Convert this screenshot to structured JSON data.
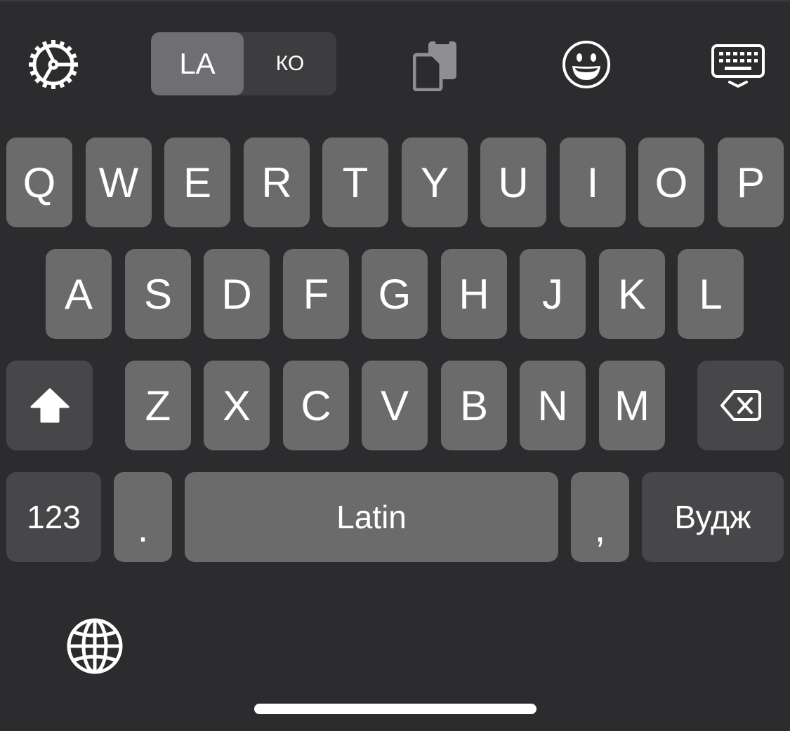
{
  "toolbar": {
    "icons": [
      "gear-icon",
      "clipboard-icon",
      "emoji-icon",
      "keyboard-dismiss-icon"
    ],
    "language_toggle": {
      "active_label": "LA",
      "inactive_label": "КО"
    }
  },
  "rows": {
    "row1": [
      "Q",
      "W",
      "E",
      "R",
      "T",
      "Y",
      "U",
      "I",
      "O",
      "P"
    ],
    "row2": [
      "A",
      "S",
      "D",
      "F",
      "G",
      "H",
      "J",
      "K",
      "L"
    ],
    "row3": [
      "Z",
      "X",
      "C",
      "V",
      "B",
      "N",
      "M"
    ]
  },
  "bottom_row": {
    "numbers_label": "123",
    "period_label": ".",
    "space_label": "Latin",
    "comma_label": ",",
    "return_label": "Вудж"
  },
  "icons": {
    "shift": "shift-icon",
    "delete": "delete-icon",
    "globe": "globe-icon"
  },
  "colors": {
    "background": "#2c2c2e",
    "key": "#6b6b6b",
    "function_key": "#474749",
    "toggle_active": "#6f6f73",
    "toggle_bg": "#3d3d40"
  }
}
